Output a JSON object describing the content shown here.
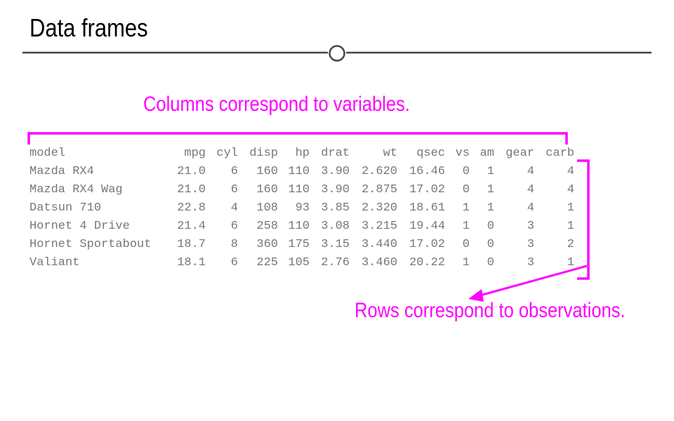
{
  "title": "Data frames",
  "annotations": {
    "columns": "Columns correspond to variables.",
    "rows": "Rows correspond to observations."
  },
  "colors": {
    "accent": "#ff00ff",
    "table_text": "#777777",
    "divider": "#444444"
  },
  "table": {
    "headers": [
      "model",
      "mpg",
      "cyl",
      "disp",
      "hp",
      "drat",
      "wt",
      "qsec",
      "vs",
      "am",
      "gear",
      "carb"
    ],
    "rows": [
      [
        "Mazda RX4",
        "21.0",
        "6",
        "160",
        "110",
        "3.90",
        "2.620",
        "16.46",
        "0",
        "1",
        "4",
        "4"
      ],
      [
        "Mazda RX4 Wag",
        "21.0",
        "6",
        "160",
        "110",
        "3.90",
        "2.875",
        "17.02",
        "0",
        "1",
        "4",
        "4"
      ],
      [
        "Datsun 710",
        "22.8",
        "4",
        "108",
        "93",
        "3.85",
        "2.320",
        "18.61",
        "1",
        "1",
        "4",
        "1"
      ],
      [
        "Hornet 4 Drive",
        "21.4",
        "6",
        "258",
        "110",
        "3.08",
        "3.215",
        "19.44",
        "1",
        "0",
        "3",
        "1"
      ],
      [
        "Hornet Sportabout",
        "18.7",
        "8",
        "360",
        "175",
        "3.15",
        "3.440",
        "17.02",
        "0",
        "0",
        "3",
        "2"
      ],
      [
        "Valiant",
        "18.1",
        "6",
        "225",
        "105",
        "2.76",
        "3.460",
        "20.22",
        "1",
        "0",
        "3",
        "1"
      ]
    ]
  }
}
